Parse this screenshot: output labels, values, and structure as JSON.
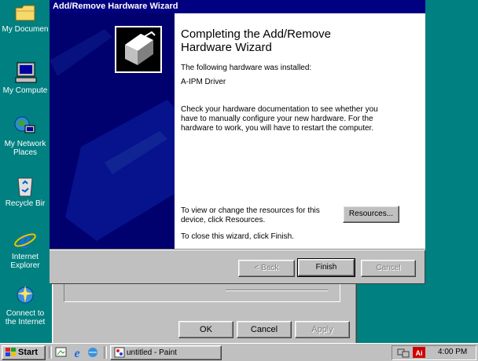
{
  "desktop": {
    "icons": [
      {
        "label": "My Documen",
        "icon": "folder-icon"
      },
      {
        "label": "My Compute",
        "icon": "computer-icon"
      },
      {
        "label": "My Network Places",
        "icon": "network-icon"
      },
      {
        "label": "Recycle Bir",
        "icon": "recycle-bin-icon"
      },
      {
        "label": "Internet Explorer",
        "icon": "ie-icon"
      },
      {
        "label": "Connect to the Internet",
        "icon": "connect-icon"
      }
    ]
  },
  "background_dialog": {
    "ok_label": "OK",
    "cancel_label": "Cancel",
    "apply_label": "Apply"
  },
  "wizard": {
    "title": "Add/Remove Hardware Wizard",
    "heading": "Completing the Add/Remove Hardware Wizard",
    "installed_intro": "The following hardware was installed:",
    "device_name": "A-IPM Driver",
    "documentation_text": "Check your hardware documentation to see whether you have to manually configure your new hardware. For the hardware to work, you will have to restart the computer.",
    "resources_text": "To view or change the resources for this device, click Resources.",
    "resources_button": "Resources...",
    "close_text": "To close this wizard, click Finish.",
    "back_button": "< Back",
    "finish_button": "Finish",
    "cancel_button": "Cancel"
  },
  "taskbar": {
    "start_label": "Start",
    "task_label": "untitled - Paint",
    "clock": "4:00 PM",
    "colors": {
      "desktop": "#008080",
      "title_bar": "#000080"
    }
  }
}
